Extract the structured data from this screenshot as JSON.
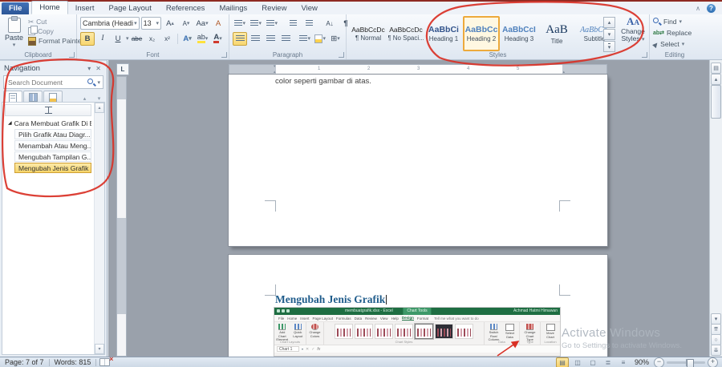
{
  "window": {
    "tabs": [
      {
        "label": "File",
        "type": "file"
      },
      {
        "label": "Home",
        "active": true
      },
      {
        "label": "Insert"
      },
      {
        "label": "Page Layout"
      },
      {
        "label": "References"
      },
      {
        "label": "Mailings"
      },
      {
        "label": "Review"
      },
      {
        "label": "View"
      }
    ]
  },
  "ribbon": {
    "clipboard": {
      "group_label": "Clipboard",
      "paste": "Paste",
      "cut": "Cut",
      "copy": "Copy",
      "format_painter": "Format Painter"
    },
    "font": {
      "group_label": "Font",
      "family": "Cambria (Headi",
      "size": "13"
    },
    "paragraph": {
      "group_label": "Paragraph"
    },
    "styles": {
      "group_label": "Styles",
      "change_styles_line1": "Change",
      "change_styles_line2": "Styles",
      "items": [
        {
          "preview": "AaBbCcDc",
          "label": "¶ Normal",
          "selected": false
        },
        {
          "preview": "AaBbCcDc",
          "label": "¶ No Spaci...",
          "selected": false
        },
        {
          "preview": "AaBbCi",
          "label": "Heading 1",
          "selected": false
        },
        {
          "preview": "AaBbCc",
          "label": "Heading 2",
          "selected": true
        },
        {
          "preview": "AaBbCcI",
          "label": "Heading 3",
          "selected": false
        },
        {
          "preview": "AaB",
          "label": "Title",
          "selected": false
        },
        {
          "preview": "AaBbCc.",
          "label": "Subtitle",
          "selected": false
        }
      ]
    },
    "editing": {
      "group_label": "Editing",
      "find": "Find",
      "replace": "Replace",
      "select": "Select"
    }
  },
  "navigation": {
    "title": "Navigation",
    "search_placeholder": "Search Document",
    "items": [
      {
        "label": "Cara Membuat Grafik Di E...",
        "level": 0,
        "selected": false
      },
      {
        "label": "Pilih Grafik Atau Diagr...",
        "level": 1,
        "selected": false
      },
      {
        "label": "Menambah Atau Meng...",
        "level": 1,
        "selected": false
      },
      {
        "label": "Mengubah Tampilan G...",
        "level": 1,
        "selected": false
      },
      {
        "label": "Mengubah Jenis Grafik",
        "level": 1,
        "selected": true
      }
    ]
  },
  "ruler": {
    "numbers": [
      "1",
      "2",
      "3",
      "4",
      "5"
    ],
    "tab_stop": "L"
  },
  "document": {
    "page1_text": "color seperti gambar di atas.",
    "page2_heading": "Mengubah Jenis Grafik"
  },
  "excel": {
    "titlebar": {
      "filename": "membuatgrafik.xlsx - Excel",
      "context_tab": "Chart Tools",
      "user": "Achmad Hatmi Himawan"
    },
    "tabs": [
      "File",
      "Home",
      "Insert",
      "Page Layout",
      "Formulas",
      "Data",
      "Review",
      "View",
      "Help",
      "Design",
      "Format"
    ],
    "active_tab": "Design",
    "tell_me": "Tell me what you want to do",
    "buttons": {
      "add_chart_element": "Add Chart Element",
      "quick_layout": "Quick Layout",
      "change_colors": "Change Colors",
      "switch_row_column": "Switch Row/ Column",
      "select_data": "Select Data",
      "change_chart_type": "Change Chart Type",
      "move_chart": "Move Chart"
    },
    "group_labels": [
      "Chart Layouts",
      "Chart Styles",
      "Data",
      "Type",
      "Location"
    ],
    "name_box": "Chart 1",
    "fx": "fx"
  },
  "status_bar": {
    "page": "Page: 7 of 7",
    "words": "Words: 815",
    "zoom_level": "90%"
  },
  "watermark": {
    "line1": "Activate Windows",
    "line2": "Go to Settings to activate Windows."
  },
  "glyphs": {
    "caret": "▾",
    "caret_up": "▴",
    "close": "✕",
    "help": "?",
    "min_ribbon": "∧",
    "bold": "B",
    "italic": "I",
    "underline": "U",
    "strike": "abe",
    "sub": "x₂",
    "sup": "x²",
    "text_effects": "A",
    "highlight": "ab",
    "font_color": "A",
    "grow": "A",
    "shrink": "A",
    "change_case": "Aa",
    "clear_format": "A",
    "pilcrow": "¶",
    "sort": "A↓",
    "borders": "⊞",
    "cut": "✂",
    "expander": "◢",
    "scroll_up": "▴",
    "scroll_down": "▾",
    "page_prev": "⇈",
    "page_next": "⇊",
    "browse_obj": "○",
    "ruler_btn": "▤",
    "minus": "−",
    "plus": "+",
    "select_arrow": "▶",
    "replace_ab": "ab⇄",
    "view_print": "▤",
    "view_full": "◫",
    "view_web": "▢",
    "view_outline": "≣",
    "view_draft": "≡",
    "xl_cancel": "✕",
    "xl_check": "✓"
  },
  "colors": {
    "annotation": "#d93025",
    "excel_green": "#1e6e42",
    "nav_selection": "#f7d569",
    "doc_bg": "#9aa1ab"
  }
}
